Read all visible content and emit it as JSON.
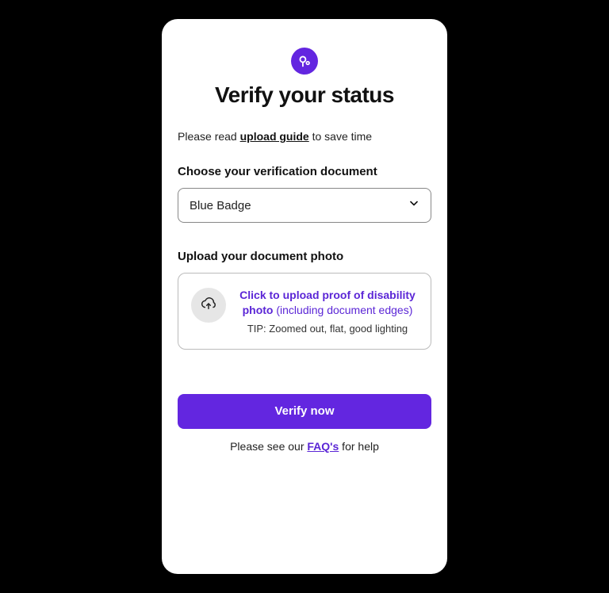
{
  "title": "Verify your status",
  "intro": {
    "prefix": "Please read ",
    "link": "upload guide",
    "suffix": " to save time"
  },
  "document_section": {
    "label": "Choose your verification document",
    "selected": "Blue Badge"
  },
  "upload_section": {
    "label": "Upload your document photo",
    "title_line1": "Click to upload proof of disability",
    "title_line2_bold": "photo",
    "title_line2_rest": " (including document edges)",
    "tip": "TIP: Zoomed out, flat, good lighting"
  },
  "verify_button": "Verify now",
  "footer": {
    "prefix": "Please see our ",
    "link": "FAQ's",
    "suffix": " for help"
  },
  "colors": {
    "accent": "#6326E0"
  }
}
